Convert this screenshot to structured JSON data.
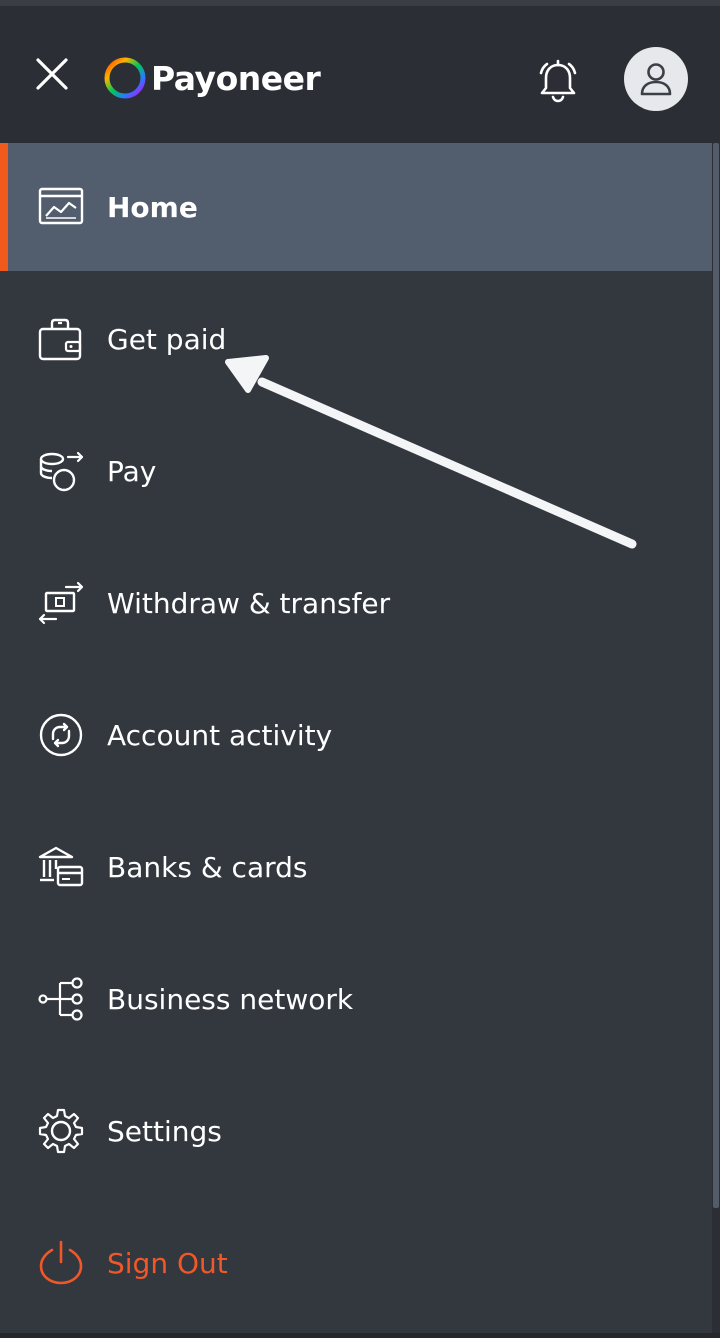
{
  "header": {
    "logo_text": "Payoneer"
  },
  "menu": {
    "items": [
      {
        "label": "Home"
      },
      {
        "label": "Get paid"
      },
      {
        "label": "Pay"
      },
      {
        "label": "Withdraw & transfer"
      },
      {
        "label": "Account activity"
      },
      {
        "label": "Banks & cards"
      },
      {
        "label": "Business network"
      },
      {
        "label": "Settings"
      },
      {
        "label": "Sign Out"
      }
    ]
  },
  "colors": {
    "header_bg": "#2b2f35",
    "menu_bg": "#33373e",
    "active_bg": "#525d6e",
    "accent": "#f25a1d",
    "signout": "#f0582a"
  },
  "icons": {
    "close": "close-icon",
    "bell": "bell-icon",
    "avatar": "user-icon",
    "home": "chart-window-icon",
    "get_paid": "wallet-icon",
    "pay": "coins-transfer-icon",
    "withdraw": "banknote-transfer-icon",
    "activity": "circular-arrows-icon",
    "banks": "bank-card-icon",
    "network": "network-nodes-icon",
    "settings": "gear-icon",
    "signout": "power-icon"
  }
}
